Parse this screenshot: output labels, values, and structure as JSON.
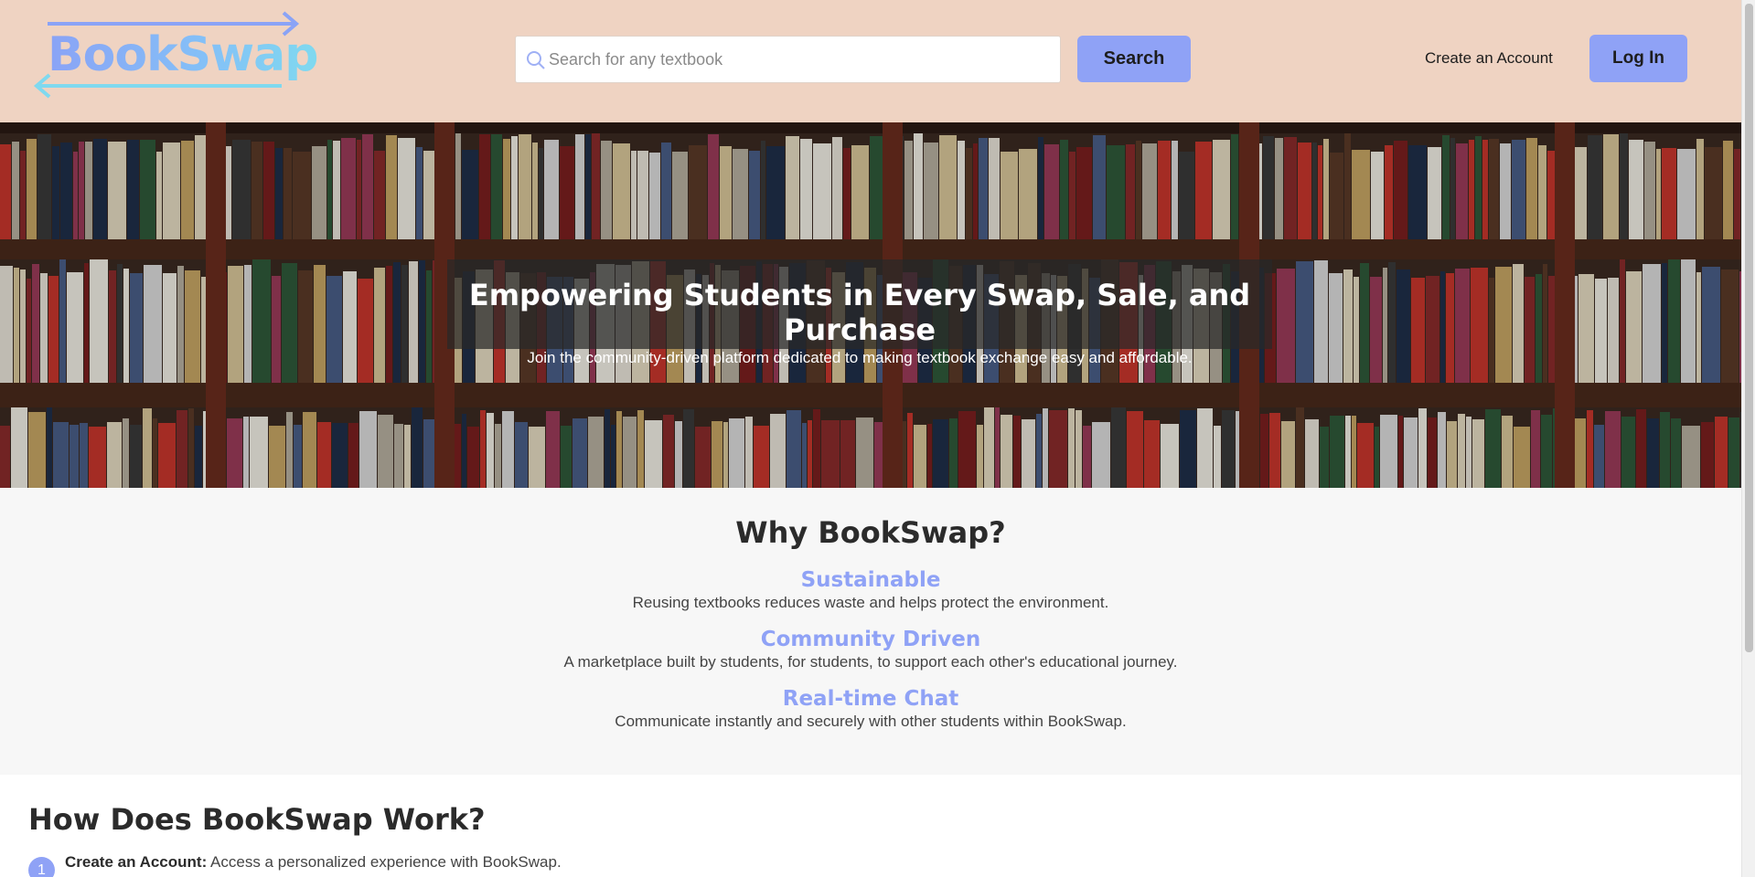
{
  "header": {
    "logo_text": "BookSwap",
    "search_placeholder": "Search for any textbook",
    "search_button": "Search",
    "create_account": "Create an Account",
    "login_button": "Log In"
  },
  "hero": {
    "title": "Empowering Students in Every Swap, Sale, and Purchase",
    "subtitle": "Join the community-driven platform dedicated to making textbook exchange easy and affordable."
  },
  "why": {
    "title": "Why BookSwap?",
    "features": [
      {
        "title": "Sustainable",
        "desc": "Reusing textbooks reduces waste and helps protect the environment."
      },
      {
        "title": "Community Driven",
        "desc": "A marketplace built by students, for students, to support each other's educational journey."
      },
      {
        "title": "Real-time Chat",
        "desc": "Communicate instantly and securely with other students within BookSwap."
      }
    ]
  },
  "how": {
    "title": "How Does BookSwap Work?",
    "steps": [
      {
        "number": "1",
        "label": "Create an Account:",
        "text": " Access a personalized experience with BookSwap."
      }
    ]
  },
  "colors": {
    "header_bg": "#efd3c2",
    "accent": "#8fa2f6",
    "section_bg": "#f7f7f7"
  },
  "icons": {
    "search": "search-icon",
    "logo_arrows": "swap-arrows-icon"
  }
}
